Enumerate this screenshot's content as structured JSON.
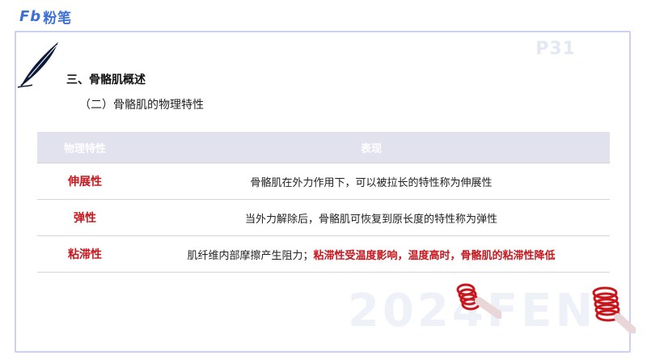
{
  "brand": {
    "logo_text": "Fb",
    "name": "粉笔"
  },
  "page_number": "P31",
  "section_title": "三、骨骼肌概述",
  "sub_title": "（二）骨骼肌的物理特性",
  "table": {
    "headers": [
      "物理特性",
      "表现"
    ],
    "rows": [
      {
        "property": "伸展性",
        "description": "骨骼肌在外力作用下，可以被拉长的特性称为伸展性"
      },
      {
        "property": "弹性",
        "description": "当外力解除后，骨骼肌可恢复到原长度的特性称为弹性"
      },
      {
        "property": "粘滞性",
        "description_plain": "肌纤维内部摩擦产生阻力；",
        "description_highlight": "粘滞性受温度影响，温度高时，骨骼肌的粘滞性降低"
      }
    ]
  },
  "watermark": "2024FEN",
  "colors": {
    "accent_red": "#c8161d",
    "brand_blue": "#3d6fd8",
    "header_bg": "#e2e1ee"
  }
}
